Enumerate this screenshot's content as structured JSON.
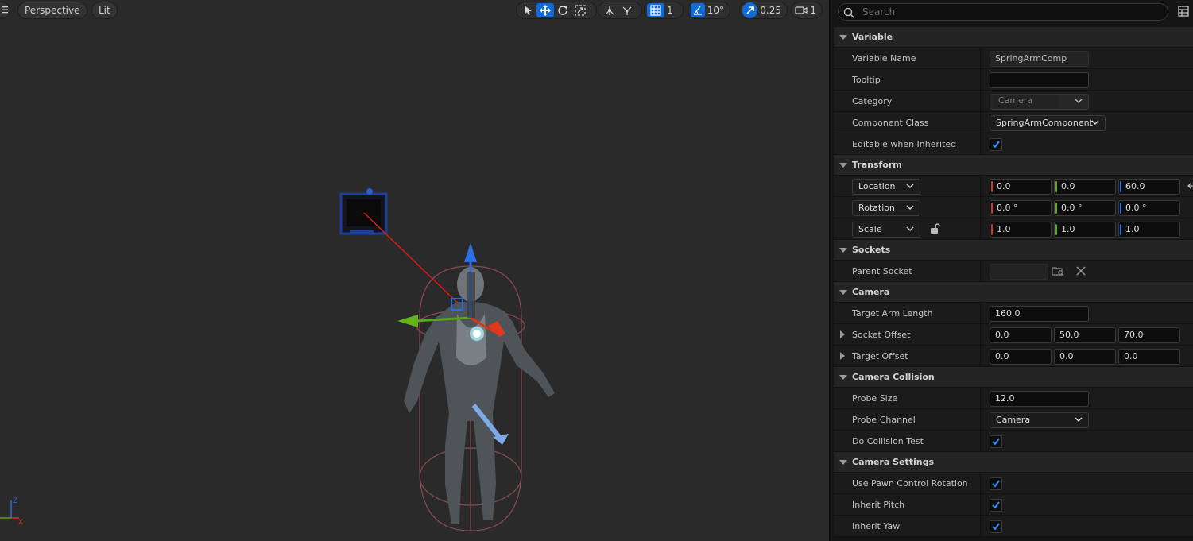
{
  "viewport": {
    "menu_icon": "hamburger-icon",
    "perspective_label": "Perspective",
    "lit_label": "Lit",
    "grid_snap_value": "1",
    "rotation_snap_value": "10°",
    "scale_snap_value": "0.25",
    "camera_speed_value": "1",
    "axis_labels": {
      "z": "Z",
      "x": "X"
    },
    "colors": {
      "background": "#2a2a2a",
      "accent": "#0f6bd8"
    }
  },
  "search": {
    "placeholder": "Search"
  },
  "sections": {
    "variable": "Variable",
    "transform": "Transform",
    "sockets": "Sockets",
    "camera": "Camera",
    "camera_collision": "Camera Collision",
    "camera_settings": "Camera Settings"
  },
  "variable": {
    "name_label": "Variable Name",
    "name_value": "SpringArmComp",
    "tooltip_label": "Tooltip",
    "tooltip_value": "",
    "category_label": "Category",
    "category_value": "Camera",
    "component_class_label": "Component Class",
    "component_class_value": "SpringArmComponent",
    "editable_label": "Editable when Inherited",
    "editable_checked": true
  },
  "transform": {
    "location_label": "Location",
    "location": {
      "x": "0.0",
      "y": "0.0",
      "z": "60.0"
    },
    "rotation_label": "Rotation",
    "rotation": {
      "x": "0.0 °",
      "y": "0.0 °",
      "z": "0.0 °"
    },
    "scale_label": "Scale",
    "scale": {
      "x": "1.0",
      "y": "1.0",
      "z": "1.0"
    }
  },
  "sockets": {
    "parent_label": "Parent Socket",
    "parent_value": ""
  },
  "camera": {
    "target_arm_length_label": "Target Arm Length",
    "target_arm_length": "160.0",
    "socket_offset_label": "Socket Offset",
    "socket_offset": {
      "x": "0.0",
      "y": "50.0",
      "z": "70.0"
    },
    "target_offset_label": "Target Offset",
    "target_offset": {
      "x": "0.0",
      "y": "0.0",
      "z": "0.0"
    }
  },
  "camera_collision": {
    "probe_size_label": "Probe Size",
    "probe_size": "12.0",
    "probe_channel_label": "Probe Channel",
    "probe_channel": "Camera",
    "do_collision_label": "Do Collision Test",
    "do_collision": true
  },
  "camera_settings": {
    "use_pawn_label": "Use Pawn Control Rotation",
    "use_pawn": true,
    "inherit_pitch_label": "Inherit Pitch",
    "inherit_pitch": true,
    "inherit_yaw_label": "Inherit Yaw",
    "inherit_yaw": true
  }
}
